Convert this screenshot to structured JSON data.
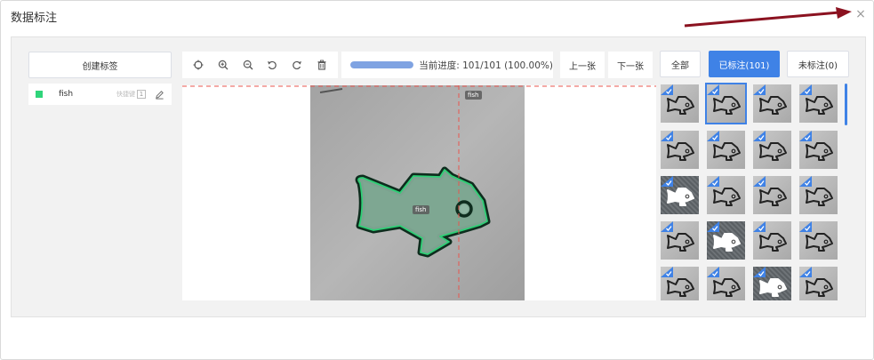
{
  "dialog": {
    "title": "数据标注",
    "close_symbol": "×"
  },
  "labels_panel": {
    "create_button": "创建标签",
    "labels": [
      {
        "name": "fish",
        "color": "#2fd47a",
        "hotkey_label": "快捷键",
        "hotkey": "1"
      }
    ]
  },
  "toolbar": {
    "tools": [
      "crosshair-icon",
      "zoom-in-icon",
      "zoom-out-icon",
      "undo-icon",
      "redo-icon",
      "delete-icon"
    ]
  },
  "progress": {
    "text": "当前进度: 101/101 (100.00%)",
    "fraction": 1.0
  },
  "nav": {
    "prev": "上一张",
    "next": "下一张"
  },
  "filters": {
    "all": "全部",
    "labeled": "已标注(101)",
    "unlabeled": "未标注(0)",
    "active": "labeled"
  },
  "canvas": {
    "shape_label": "fish",
    "crosshair_label": "fish",
    "accent": "#3f82e6"
  },
  "thumbnails": [
    {
      "variant": "light"
    },
    {
      "variant": "light",
      "selected": true
    },
    {
      "variant": "light"
    },
    {
      "variant": "light"
    },
    {
      "variant": "light"
    },
    {
      "variant": "light"
    },
    {
      "variant": "light"
    },
    {
      "variant": "light"
    },
    {
      "variant": "dark"
    },
    {
      "variant": "light"
    },
    {
      "variant": "light"
    },
    {
      "variant": "light"
    },
    {
      "variant": "light"
    },
    {
      "variant": "dark"
    },
    {
      "variant": "light"
    },
    {
      "variant": "light"
    },
    {
      "variant": "light"
    },
    {
      "variant": "light"
    },
    {
      "variant": "dark"
    },
    {
      "variant": "light"
    }
  ]
}
